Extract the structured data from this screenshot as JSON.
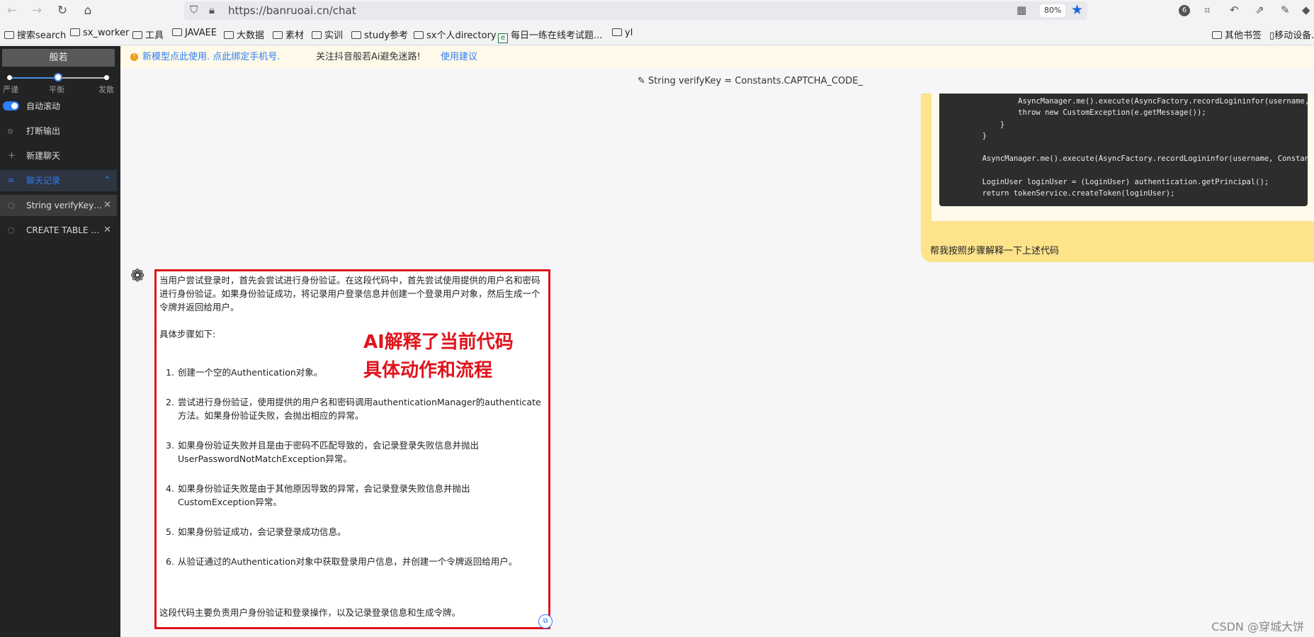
{
  "browser": {
    "url": "https://banruoai.cn/chat",
    "zoom": "80%",
    "extension_badge": "6",
    "bookmarks": [
      "搜索search",
      "sx_worker",
      "工具",
      "JAVAEE",
      "大数据",
      "素材",
      "实训",
      "study参考",
      "sx个人directory",
      "每日一练在线考试题...",
      "yl"
    ],
    "bookmarks_right": [
      "其他书签",
      "移动设备..."
    ]
  },
  "sidebar": {
    "model_button": "般若",
    "slider": {
      "labels": [
        "严谨",
        "平衡",
        "发散"
      ],
      "value": 0.5
    },
    "auto_scroll_label": "自动滚动",
    "print_output_label": "打断输出",
    "new_chat_label": "新建聊天",
    "history_label": "聊天记录",
    "chats": [
      {
        "title": "String verifyKey = C..."
      },
      {
        "title": "CREATE TABLE `tb_..."
      }
    ]
  },
  "notice": {
    "link1": "新模型点此使用. 点此绑定手机号.",
    "text": "关注抖音般若Ai避免迷路!",
    "link2": "使用建议"
  },
  "chat": {
    "title_icon": "pencil-icon",
    "title": "String verifyKey = Constants.CAPTCHA_CODE_",
    "user_code": "                AsyncManager.me().execute(AsyncFactory.recordLogininfor(username, Constants.LOGIN_FAIL, e.getMessage()));\n                throw new CustomException(e.getMessage());\n            }\n        }\n\n        AsyncManager.me().execute(AsyncFactory.recordLogininfor(username, Constants.LOGIN_SUCCESS, MessageUtils.message(\"user.login.success\")));\n\n        LoginUser loginUser = (LoginUser) authentication.getPrincipal();\n        return tokenService.createToken(loginUser);",
    "user_text": "帮我按照步骤解释一下上述代码",
    "ai_intro": "当用户尝试登录时，首先会尝试进行身份验证。在这段代码中，首先尝试使用提供的用户名和密码进行身份验证。如果身份验证成功，将记录用户登录信息并创建一个登录用户对象，然后生成一个令牌并返回给用户。",
    "ai_steps_heading": "具体步骤如下:",
    "ai_steps": [
      "创建一个空的Authentication对象。",
      "尝试进行身份验证，使用提供的用户名和密码调用authenticationManager的authenticate方法。如果身份验证失败，会抛出相应的异常。",
      "如果身份验证失败并且是由于密码不匹配导致的，会记录登录失败信息并抛出UserPasswordNotMatchException异常。",
      "如果身份验证失败是由于其他原因导致的异常，会记录登录失败信息并抛出CustomException异常。",
      "如果身份验证成功，会记录登录成功信息。",
      "从验证通过的Authentication对象中获取登录用户信息，并创建一个令牌返回给用户。"
    ],
    "ai_summary": "这段代码主要负责用户身份验证和登录操作，以及记录登录信息和生成令牌。"
  },
  "annotation": [
    "AI解释了当前代码",
    "具体动作和流程"
  ],
  "watermark": "CSDN @穿城大饼",
  "colors": {
    "accent": "#2f7df6",
    "highlight": "#e0131c",
    "user_bubble": "#fde38a"
  }
}
